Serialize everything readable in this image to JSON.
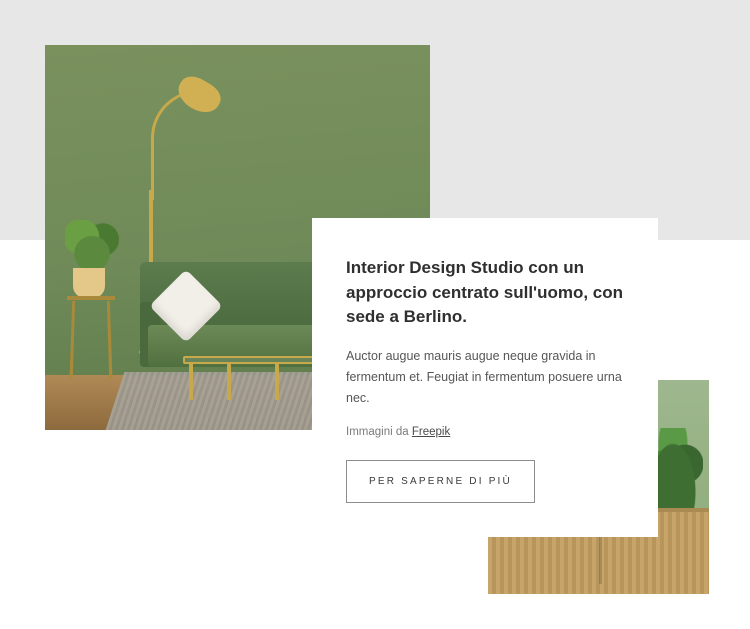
{
  "card": {
    "heading": "Interior Design Studio con un approccio centrato sull'uomo, con sede a Berlino.",
    "body": "Auctor augue mauris augue neque gravida in fermentum et. Feugiat in fermentum posuere urna nec.",
    "credit_prefix": "Immagini da ",
    "credit_link_text": "Freepik",
    "cta_label": "PER SAPERNE DI PIÙ"
  },
  "icons": {
    "hero_image": "interior-green-sofa-scene",
    "side_image": "interior-sideboard-plants-scene"
  },
  "colors": {
    "page_bg": "#ffffff",
    "band_bg": "#e7e7e7",
    "accent_green": "#6f8a58",
    "button_border": "#8d8d8d"
  }
}
